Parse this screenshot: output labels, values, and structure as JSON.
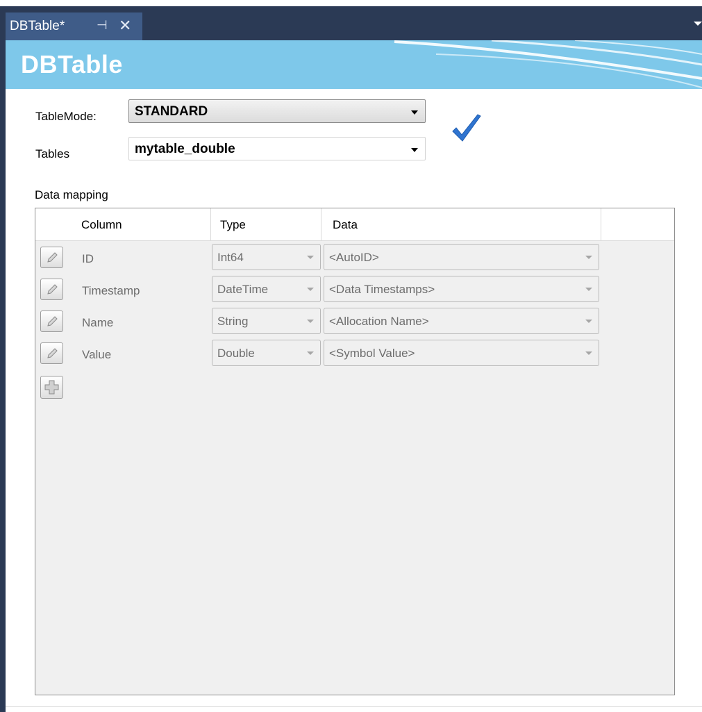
{
  "tab": {
    "title": "DBTable*",
    "pin_glyph": "⊣",
    "close_glyph": "✕"
  },
  "header": {
    "title": "DBTable"
  },
  "form": {
    "table_mode_label": "TableMode:",
    "table_mode_value": "STANDARD",
    "tables_label": "Tables",
    "tables_value": "mytable_double"
  },
  "mapping": {
    "label": "Data mapping",
    "columns": [
      "Column",
      "Type",
      "Data"
    ],
    "rows": [
      {
        "column": "ID",
        "type": "Int64",
        "data": "<AutoID>"
      },
      {
        "column": "Timestamp",
        "type": "DateTime",
        "data": "<Data Timestamps>"
      },
      {
        "column": "Name",
        "type": "String",
        "data": "<Allocation Name>"
      },
      {
        "column": "Value",
        "type": "Double",
        "data": "<Symbol Value>"
      }
    ]
  },
  "icons": {
    "pin": "pin-icon",
    "close": "close-icon",
    "checkmark": "checkmark-icon",
    "edit": "pencil-icon",
    "add": "plus-icon",
    "dropdown": "chevron-down-icon"
  },
  "colors": {
    "tab_bar": "#2b3a55",
    "active_tab": "#3f5c88",
    "header_bg": "#7ec8ea",
    "check": "#2f74d0"
  }
}
